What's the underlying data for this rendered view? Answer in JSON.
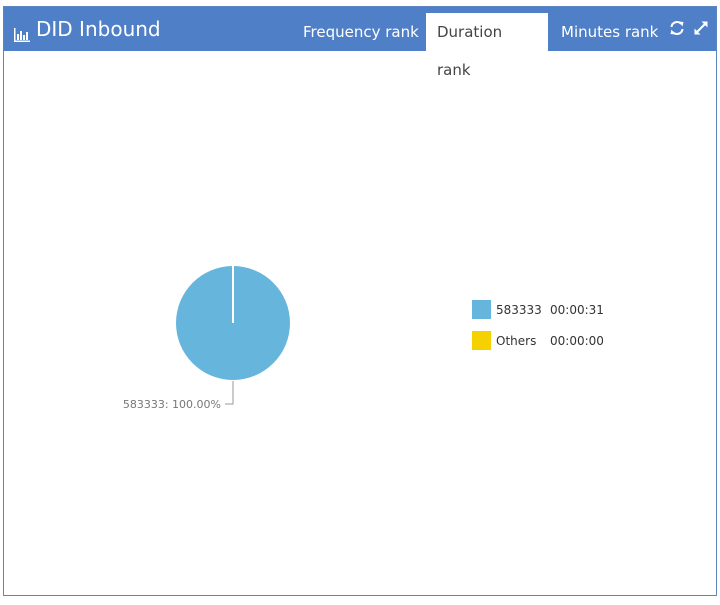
{
  "header": {
    "title": "DID Inbound",
    "title_icon": "bar-chart-icon",
    "tabs": [
      {
        "label": "Frequency rank",
        "active": false
      },
      {
        "label": "Duration rank",
        "active": true
      },
      {
        "label": "Minutes rank",
        "active": false
      }
    ],
    "actions": [
      {
        "icon": "refresh-icon"
      },
      {
        "icon": "expand-icon"
      }
    ]
  },
  "colors": {
    "header_bg": "#4f7fc7",
    "series_583333": "#66b5dc",
    "series_others": "#f5d100"
  },
  "chart_data": {
    "type": "pie",
    "slices": [
      {
        "name": "583333",
        "value_label": "00:00:31",
        "seconds": 31,
        "percent": 100.0,
        "color": "#66b5dc"
      },
      {
        "name": "Others",
        "value_label": "00:00:00",
        "seconds": 0,
        "percent": 0.0,
        "color": "#f5d100"
      }
    ],
    "slice_label": "583333: 100.00%",
    "legend_position": "right"
  }
}
